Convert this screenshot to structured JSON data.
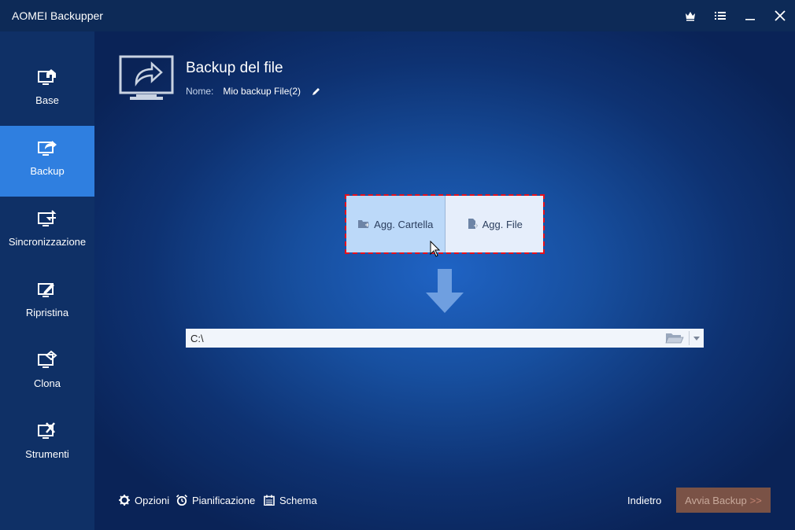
{
  "app": {
    "title": "AOMEI Backupper"
  },
  "window_controls": [
    {
      "name": "upgrade-crown-icon",
      "icon": "crown-icon"
    },
    {
      "name": "menu-button",
      "icon": "menu-icon"
    },
    {
      "name": "minimize-button",
      "icon": "minimize-icon"
    },
    {
      "name": "close-button",
      "icon": "close-icon"
    }
  ],
  "sidebar": {
    "items": [
      {
        "label": "Base",
        "icon": "home-monitor-icon",
        "active": false
      },
      {
        "label": "Backup",
        "icon": "backup-monitor-icon",
        "active": true
      },
      {
        "label": "Sincronizzazione",
        "icon": "sync-monitor-icon",
        "active": false
      },
      {
        "label": "Ripristina",
        "icon": "restore-monitor-icon",
        "active": false
      },
      {
        "label": "Clona",
        "icon": "clone-monitor-icon",
        "active": false
      },
      {
        "label": "Strumenti",
        "icon": "tools-monitor-icon",
        "active": false
      }
    ]
  },
  "header": {
    "title": "Backup del file",
    "name_label": "Nome:",
    "name_value": "Mio backup File(2)"
  },
  "source": {
    "add_folder_label": "Agg. Cartella",
    "add_file_label": "Agg. File"
  },
  "destination": {
    "value": "C:\\"
  },
  "footer": {
    "options_label": "Opzioni",
    "schedule_label": "Pianificazione",
    "scheme_label": "Schema",
    "back_label": "Indietro",
    "start_label": "Avvia Backup",
    "start_chevron": ">>"
  },
  "colors": {
    "active_nav": "#2f7fe0",
    "highlight_border": "#e8101a",
    "start_button": "#7a5246"
  }
}
